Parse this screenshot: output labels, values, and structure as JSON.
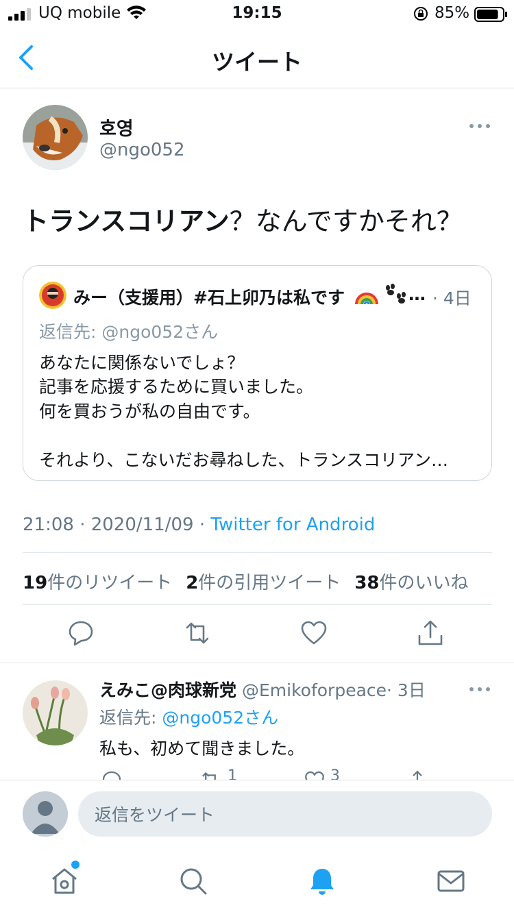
{
  "status_bar": {
    "carrier": "UQ mobile",
    "time": "19:15",
    "battery": "85%",
    "battery_level": 0.85
  },
  "header": {
    "title": "ツイート"
  },
  "tweet": {
    "author_name": "호영",
    "author_handle": "@ngo052",
    "text_bold": "トランスコリアン",
    "text_rest": "？なんですかそれ？",
    "quote": {
      "name": "みー（支援用）#石上卯乃は私です",
      "ellipsis": "…",
      "date": "· 4日",
      "reply_to": "返信先: @ngo052さん",
      "lines": [
        "あなたに関係ないでしょ？",
        "記事を応援するために買いました。",
        "何を買おうが私の自由です。",
        "それより、こないだお尋ねした、トランスコリアン…"
      ]
    },
    "time_date": "21:08 · 2020/11/09 · ",
    "app": "Twitter for Android",
    "stats": {
      "retweets_count": "19",
      "retweets_label": "件のリツイート",
      "quotes_count": "2",
      "quotes_label": "件の引用ツイート",
      "likes_count": "38",
      "likes_label": "件のいいね"
    }
  },
  "reply": {
    "name": "えみこ@肉球新党",
    "handle": "@Emikoforpeace",
    "date": "· 3日",
    "reply_prefix": "返信先: ",
    "reply_mention": "@ngo052さん",
    "text": "私も、初めて聞きました。",
    "retweet_count": "1",
    "like_count": "3"
  },
  "composer": {
    "placeholder": "返信をツイート"
  },
  "tabs": [
    "home-icon",
    "search-icon",
    "notifications-icon",
    "messages-icon"
  ],
  "colors": {
    "accent": "#1da1f2",
    "secondary_text": "#657786",
    "border": "#e1e6ea"
  }
}
